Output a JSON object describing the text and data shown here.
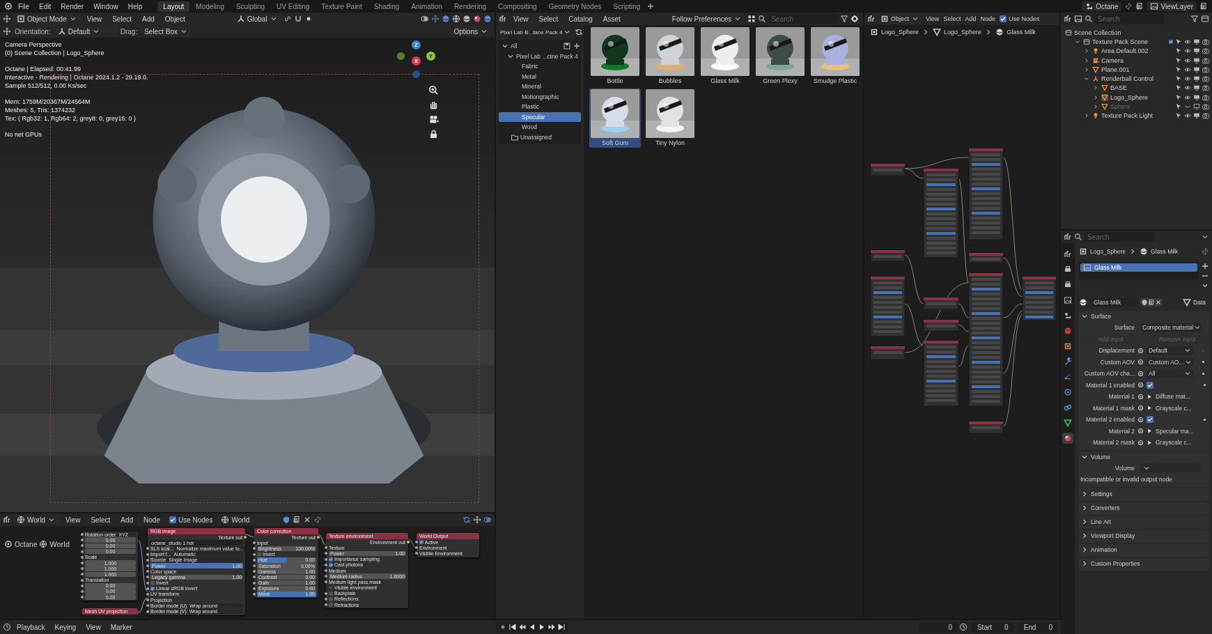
{
  "top_bar": {
    "menus": [
      "File",
      "Edit",
      "Render",
      "Window",
      "Help"
    ],
    "workspaces": [
      {
        "label": "Layout",
        "selected": true
      },
      {
        "label": "Modeling",
        "selected": false
      },
      {
        "label": "Sculpting",
        "selected": false
      },
      {
        "label": "UV Editing",
        "selected": false
      },
      {
        "label": "Texture Paint",
        "selected": false
      },
      {
        "label": "Shading",
        "selected": false
      },
      {
        "label": "Animation",
        "selected": false
      },
      {
        "label": "Rendering",
        "selected": false
      },
      {
        "label": "Compositing",
        "selected": false
      },
      {
        "label": "Geometry Nodes",
        "selected": false
      },
      {
        "label": "Scripting",
        "selected": false
      }
    ],
    "scene": "Octane",
    "view_layer": "ViewLayer"
  },
  "viewport": {
    "mode": "Object Mode",
    "menus": [
      "View",
      "Select",
      "Add",
      "Object"
    ],
    "transform_orientation": "Global",
    "orientation_label": "Orientation:",
    "orientation": "Default",
    "drag_label": "Drag:",
    "drag": "Select Box",
    "options": "Options",
    "overlay_text": [
      [
        "Camera Perspective",
        "(0) Scene Collection | Logo_Sphere"
      ],
      [
        "Octane | Elapsed: 00:41.99",
        "Interactive - Rendering | Octane 2024.1.2 - 29.19.0.",
        "Sample 512/512, 0.00 Ks/sec"
      ],
      [
        "Mem: 1759M/20367M/24564M",
        "Meshes: 5, Tris: 1374232",
        "Tex: ( Rgb32: 1, Rgb64: 2, grey8: 0, grey16: 0 )"
      ],
      [
        "No net GPUs"
      ]
    ],
    "gizmo_axes": [
      "Z",
      "X",
      "Y"
    ]
  },
  "world_editor": {
    "world_type": "World",
    "menus": [
      "View",
      "Select",
      "Add",
      "Node"
    ],
    "use_nodes": {
      "label": "Use Nodes",
      "checked": true
    },
    "world": "World",
    "breadcrumb": [
      "Octane",
      "World"
    ],
    "nodes": [
      {
        "rows": [
          {
            "kind": "dropdown",
            "label": "Rotation order",
            "value": "XYZ"
          },
          {
            "kind": "field",
            "value": "0.00"
          },
          {
            "kind": "field",
            "value": "0.00"
          },
          {
            "kind": "field",
            "value": "0.00"
          },
          {
            "kind": "socket",
            "label": "Scale"
          },
          {
            "kind": "field",
            "value": "1.000"
          },
          {
            "kind": "field",
            "value": "1.000"
          },
          {
            "kind": "field",
            "value": "1.000"
          },
          {
            "kind": "socket",
            "label": "Translation"
          },
          {
            "kind": "field",
            "value": "0.00"
          },
          {
            "kind": "field",
            "value": "0.00"
          },
          {
            "kind": "field",
            "value": "0.00"
          }
        ]
      },
      {
        "title": "RGB image",
        "rows": [
          {
            "kind": "out",
            "label": "Texture out"
          },
          {
            "kind": "file",
            "value": "octane_studio 1.hdr"
          },
          {
            "kind": "dropdown",
            "label": "SLS scal...",
            "value": "Normalize maximum value to..."
          },
          {
            "kind": "dropdown",
            "label": "Import f...",
            "value": "Automatic"
          },
          {
            "kind": "dropdown",
            "label": "Source",
            "value": "Single Image"
          },
          {
            "kind": "bar",
            "label": "Power",
            "value": "1.00",
            "level": 1
          },
          {
            "kind": "socket",
            "label": "Color space"
          },
          {
            "kind": "field",
            "label": "Legacy gamma",
            "value": "1.00"
          },
          {
            "kind": "check",
            "label": "Invert",
            "checked": false
          },
          {
            "kind": "check",
            "label": "Linear sRGB invert",
            "checked": true
          },
          {
            "kind": "socket",
            "label": "UV transform"
          },
          {
            "kind": "socket",
            "label": "Projection"
          },
          {
            "kind": "dropdown",
            "label": "Border mode (U)",
            "value": "Wrap around"
          },
          {
            "kind": "dropdown",
            "label": "Border mode (V)",
            "value": "Wrap around"
          }
        ]
      },
      {
        "title": "Color correction",
        "rows": [
          {
            "kind": "out",
            "label": "Texture out"
          },
          {
            "kind": "socket",
            "label": "Input"
          },
          {
            "kind": "field",
            "label": "Brightness",
            "value": "100.00%"
          },
          {
            "kind": "check",
            "label": "Invert",
            "checked": false
          },
          {
            "kind": "bar",
            "label": "Hue",
            "value": "0.00",
            "level": 0.5
          },
          {
            "kind": "field",
            "label": "Saturation",
            "value": "0.00%"
          },
          {
            "kind": "field",
            "label": "Gamma",
            "value": "1.00"
          },
          {
            "kind": "field",
            "label": "Contrast",
            "value": "0.00"
          },
          {
            "kind": "field",
            "label": "Gain",
            "value": "1.00"
          },
          {
            "kind": "field",
            "label": "Exposure",
            "value": "0.00"
          },
          {
            "kind": "bar",
            "label": "Mask",
            "value": "1.00",
            "level": 1
          }
        ]
      },
      {
        "title": "Texture environment",
        "rows": [
          {
            "kind": "out",
            "label": "Environment out"
          },
          {
            "kind": "socket",
            "label": "Texture"
          },
          {
            "kind": "field",
            "label": "Power",
            "value": "1.00"
          },
          {
            "kind": "check",
            "label": "Importance sampling",
            "checked": true
          },
          {
            "kind": "check",
            "label": "Cast photons",
            "checked": true
          },
          {
            "kind": "socket",
            "label": "Medium"
          },
          {
            "kind": "field",
            "label": "Medium radius",
            "value": "1.0000"
          },
          {
            "kind": "socket",
            "label": "Medium light pass mask"
          },
          {
            "kind": "panel",
            "label": "Visible environment"
          },
          {
            "kind": "check",
            "label": "Backplate",
            "checked": false
          },
          {
            "kind": "check",
            "label": "Reflections",
            "checked": false
          },
          {
            "kind": "check",
            "label": "Refractions",
            "checked": false
          }
        ]
      },
      {
        "title": "World Output",
        "rows": [
          {
            "kind": "check",
            "label": "Active",
            "checked": true
          },
          {
            "kind": "socket",
            "label": "Environment"
          },
          {
            "kind": "socket",
            "label": "Visible Environment"
          }
        ]
      },
      {
        "title": "Mesh UV projection"
      }
    ]
  },
  "asset_browser": {
    "menus": [
      "View",
      "Select",
      "Catalog",
      "Asset"
    ],
    "import_method": "Follow Preferences",
    "search": {
      "placeholder": "Search"
    },
    "library": "Pixel Lab B...tane Pack 4",
    "catalogs": [
      {
        "label": "All",
        "expanded": true,
        "selected": false,
        "children": [
          {
            "label": "Pixel Lab ...ctne Pack 4",
            "expanded": true,
            "selected": false,
            "children": [
              {
                "label": "Fabric",
                "selected": false
              },
              {
                "label": "Metal",
                "selected": false
              },
              {
                "label": "Mineral",
                "selected": false
              },
              {
                "label": "Motiongraphic",
                "selected": false
              },
              {
                "label": "Plastic",
                "selected": false
              },
              {
                "label": "Specular",
                "selected": true
              },
              {
                "label": "Wood",
                "selected": false
              }
            ]
          }
        ]
      },
      {
        "label": "Unassigned",
        "selected": false
      }
    ],
    "assets": [
      {
        "name": "Bottle",
        "selected": false
      },
      {
        "name": "Bubbles",
        "selected": false
      },
      {
        "name": "Glass Milk",
        "selected": false
      },
      {
        "name": "Green Plexy",
        "selected": false
      },
      {
        "name": "Smudge Plastic",
        "selected": false
      },
      {
        "name": "Soft Gum",
        "selected": true
      },
      {
        "name": "Tiny Nylon",
        "selected": false
      }
    ]
  },
  "shader_editor": {
    "object_type": "Object",
    "menus": [
      "View",
      "Select",
      "Add",
      "Node"
    ],
    "use_nodes": {
      "label": "Use Nodes",
      "checked": true
    },
    "breadcrumb": [
      "Logo_Sphere",
      "Logo_Sphere",
      "Glass Milk"
    ]
  },
  "outliner": {
    "search": {
      "placeholder": "Search"
    },
    "tree": [
      {
        "name": "Scene Collection",
        "kind": "collection",
        "selected": false,
        "hidden": false,
        "children": [
          {
            "name": "Texture Pack Scene",
            "kind": "collection",
            "expanded": true,
            "checked": true,
            "selected": false,
            "hidden": false,
            "children": [
              {
                "name": "Area.Default.002",
                "kind": "light",
                "expanded": false,
                "selected": false,
                "hidden": false
              },
              {
                "name": "Camera",
                "kind": "camera",
                "expanded": false,
                "selected": false,
                "hidden": false
              },
              {
                "name": "Plane.001",
                "kind": "mesh",
                "expanded": false,
                "selected": false,
                "hidden": false
              },
              {
                "name": "Renderball Control",
                "kind": "empty",
                "expanded": true,
                "selected": false,
                "hidden": false,
                "children": [
                  {
                    "name": "BASE",
                    "kind": "mesh",
                    "expanded": false,
                    "selected": false,
                    "hidden": false
                  },
                  {
                    "name": "Logo_Sphere",
                    "kind": "mesh",
                    "expanded": false,
                    "selected": true,
                    "hidden": false
                  },
                  {
                    "name": "Sphere",
                    "kind": "mesh",
                    "expanded": false,
                    "selected": false,
                    "hidden": true
                  }
                ]
              },
              {
                "name": "Texture Pack Light",
                "kind": "light",
                "expanded": false,
                "selected": false,
                "hidden": false
              }
            ]
          }
        ]
      }
    ]
  },
  "properties": {
    "search": {
      "placeholder": "Search"
    },
    "tabs": [
      {
        "kind": "tool",
        "selected": false
      },
      {
        "kind": "render",
        "selected": false
      },
      {
        "kind": "output",
        "selected": false
      },
      {
        "kind": "view_layer",
        "selected": false
      },
      {
        "kind": "scene",
        "selected": false
      },
      {
        "kind": "world",
        "selected": false
      },
      {
        "kind": "object",
        "selected": false
      },
      {
        "kind": "modifiers",
        "selected": false
      },
      {
        "kind": "particles",
        "selected": false
      },
      {
        "kind": "physics",
        "selected": false
      },
      {
        "kind": "constraints",
        "selected": false
      },
      {
        "kind": "data",
        "selected": false
      },
      {
        "kind": "material",
        "selected": true
      }
    ],
    "breadcrumb": [
      "Logo_Sphere",
      "Glass Milk"
    ],
    "slots": [
      {
        "name": "Glass Milk",
        "selected": true
      }
    ],
    "material": "Glass Milk",
    "data_link": "Data",
    "panels": [
      {
        "title": "Surface",
        "expanded": true,
        "rows": [
          {
            "kind": "dropdown",
            "label": "Surface",
            "value": "Composite material"
          },
          {
            "kind": "buttons",
            "items": [
              "Add input",
              "Remove input"
            ],
            "disabled": true
          },
          {
            "kind": "socket_dropdown",
            "label": "Displacement",
            "value": "Default",
            "keyed": false
          },
          {
            "kind": "socket_dropdown",
            "label": "Custom AOV",
            "value": "Custom AO...",
            "keyed": true
          },
          {
            "kind": "socket_dropdown",
            "label": "Custom AOV cha...",
            "value": "All",
            "keyed": true
          },
          {
            "kind": "checkbox",
            "label": "Material 1 enabled",
            "checked": true,
            "keyed": true
          },
          {
            "kind": "link",
            "label": "Material 1",
            "value": "Diffuse mat..."
          },
          {
            "kind": "link",
            "label": "Material 1 mask",
            "value": "Grayscale c..."
          },
          {
            "kind": "checkbox",
            "label": "Material 2 enabled",
            "checked": true,
            "keyed": true
          },
          {
            "kind": "link",
            "label": "Material 2",
            "value": "Specular ma..."
          },
          {
            "kind": "link",
            "label": "Material 2 mask",
            "value": "Grayscale c..."
          }
        ]
      },
      {
        "title": "Volume",
        "expanded": true,
        "rows": [
          {
            "kind": "dropdown",
            "label": "Volume"
          },
          {
            "kind": "message",
            "label": "Incompatible or invalid output node"
          }
        ]
      },
      {
        "title": "Settings",
        "expanded": false
      },
      {
        "title": "Converters",
        "expanded": false
      },
      {
        "title": "Line Art",
        "expanded": false
      },
      {
        "title": "Viewport Display",
        "expanded": false
      },
      {
        "title": "Animation",
        "expanded": false
      },
      {
        "title": "Custom Properties",
        "expanded": false
      }
    ]
  },
  "timeline": {
    "menus": [
      "Playback",
      "Keying",
      "View",
      "Marker"
    ],
    "current_frame": "0",
    "start_label": "Start",
    "start": "0",
    "end_label": "End",
    "end": "0"
  }
}
